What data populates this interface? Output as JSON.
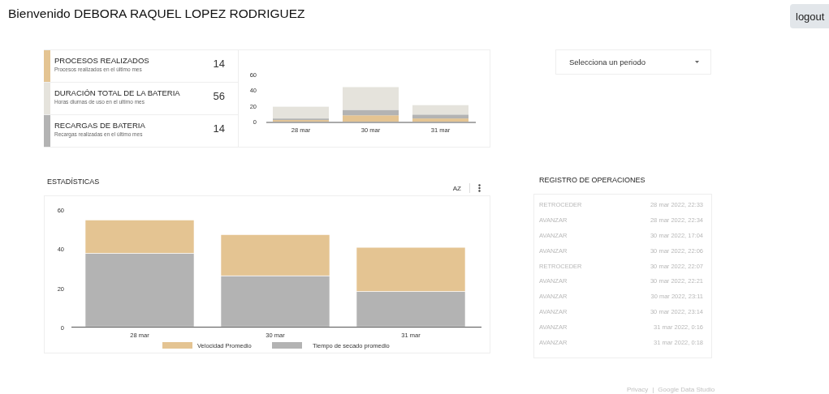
{
  "header": {
    "greeting": "Bienvenido DEBORA RAQUEL LOPEZ RODRIGUEZ",
    "logout_button": "logout"
  },
  "scorecards": [
    {
      "title": "PROCESOS REALIZADOS",
      "subtitle": "Procesos realizados en el último mes",
      "value": "14",
      "color": "#e4c492"
    },
    {
      "title": "DURACIÓN TOTAL DE LA BATERIA",
      "subtitle": "Horas diurnas de uso en el ultimo mes",
      "value": "56",
      "color": "#e5e3dc"
    },
    {
      "title": "RECARGAS DE BATERIA",
      "subtitle": "Recargas realizadas en el último mes",
      "value": "14",
      "color": "#b3b3b3"
    }
  ],
  "summary_chart": {
    "chart_data": {
      "type": "bar",
      "stacked": true,
      "categories": [
        "28 mar",
        "30 mar",
        "31 mar"
      ],
      "yticks": [
        0,
        20,
        40,
        60
      ],
      "ylim": [
        0,
        60
      ],
      "series": [
        {
          "color": "#e4c492",
          "values": [
            2,
            8,
            4
          ]
        },
        {
          "color": "#b3b3b3",
          "values": [
            2,
            7,
            5
          ]
        },
        {
          "color": "#e5e3dc",
          "values": [
            15,
            29,
            12
          ]
        }
      ]
    }
  },
  "period_dropdown": {
    "placeholder": "Selecciona un periodo"
  },
  "statistics": {
    "title": "ESTADÍSTICAS",
    "sort_button": "AZ",
    "chart_data": {
      "type": "bar",
      "stacked": true,
      "categories": [
        "28 mar",
        "30 mar",
        "31 mar"
      ],
      "yticks": [
        0,
        20,
        40,
        60
      ],
      "ylim": [
        0,
        60
      ],
      "series": [
        {
          "name": "Tiempo de secado promedio",
          "color": "#b3b3b3",
          "values": [
            37.5,
            26,
            18
          ]
        },
        {
          "name": "Velocidad Promedio",
          "color": "#e4c492",
          "values": [
            17,
            21,
            22.5
          ]
        }
      ],
      "legend": true
    }
  },
  "operations_log": {
    "title": "REGISTRO DE OPERACIONES",
    "rows": [
      {
        "operation": "RETROCEDER",
        "time": "28 mar 2022, 22:33"
      },
      {
        "operation": "AVANZAR",
        "time": "28 mar 2022, 22:34"
      },
      {
        "operation": "AVANZAR",
        "time": "30 mar 2022, 17:04"
      },
      {
        "operation": "AVANZAR",
        "time": "30 mar 2022, 22:06"
      },
      {
        "operation": "RETROCEDER",
        "time": "30 mar 2022, 22:07"
      },
      {
        "operation": "AVANZAR",
        "time": "30 mar 2022, 22:21"
      },
      {
        "operation": "AVANZAR",
        "time": "30 mar 2022, 23:11"
      },
      {
        "operation": "AVANZAR",
        "time": "30 mar 2022, 23:14"
      },
      {
        "operation": "AVANZAR",
        "time": "31 mar 2022, 0:16"
      },
      {
        "operation": "AVANZAR",
        "time": "31 mar 2022, 0:18"
      }
    ]
  },
  "footer": {
    "privacy_link": "Privacy",
    "separator": "|",
    "brand": "Google Data Studio"
  }
}
